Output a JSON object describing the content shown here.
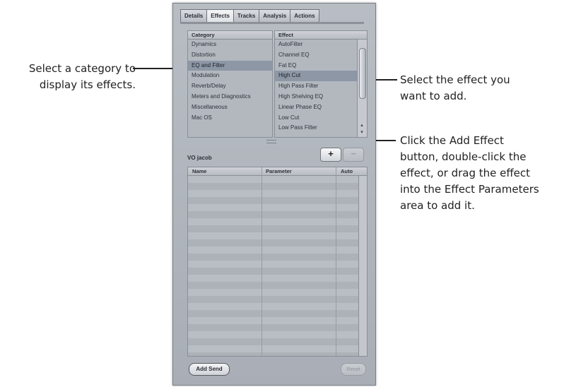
{
  "callouts": {
    "category": [
      "Select a category to",
      "display its effects."
    ],
    "effect": [
      "Select the effect you",
      "want to add."
    ],
    "add": [
      "Click the Add Effect",
      "button, double-click the",
      "effect, or drag the effect",
      "into the Effect Parameters",
      "area to add it."
    ]
  },
  "tabs": [
    "Details",
    "Effects",
    "Tracks",
    "Analysis",
    "Actions"
  ],
  "active_tab": "Effects",
  "category_pane": {
    "header": "Category",
    "items": [
      "Dynamics",
      "Distortion",
      "EQ and Filter",
      "Modulation",
      "Reverb/Delay",
      "Meters and Diagnostics",
      "Miscellaneous",
      "Mac OS"
    ],
    "selected": "EQ and Filter"
  },
  "effect_pane": {
    "header": "Effect",
    "items": [
      "AutoFilter",
      "Channel EQ",
      "Fat EQ",
      "High Cut",
      "High Pass Filter",
      "High Shelving EQ",
      "Linear Phase EQ",
      "Low Cut",
      "Low Pass Filter"
    ],
    "selected": "High Cut"
  },
  "track_name": "VO jacob",
  "add_effect_symbol": "+",
  "remove_effect_symbol": "−",
  "param_table": {
    "columns": [
      "Name",
      "Parameter",
      "Auto"
    ]
  },
  "add_send_label": "Add Send",
  "reset_label": "Reset"
}
